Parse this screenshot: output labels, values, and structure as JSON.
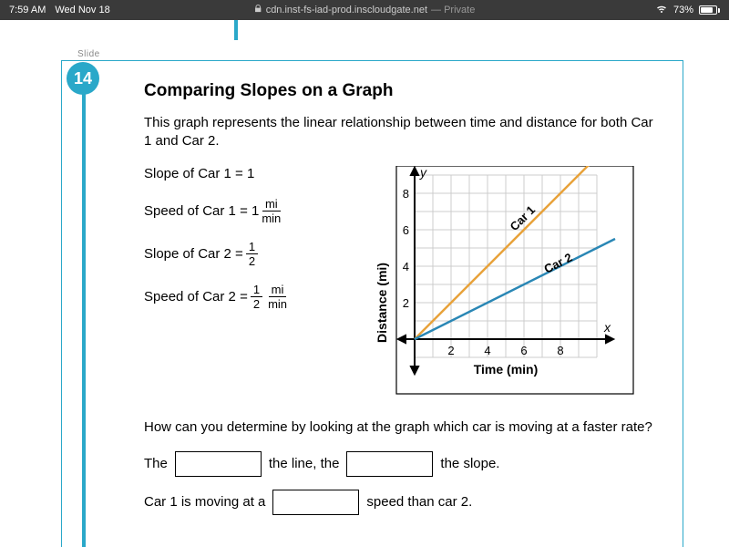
{
  "status": {
    "time": "7:59 AM",
    "date": "Wed Nov 18",
    "url": "cdn.inst-fs-iad-prod.inscloudgate.net",
    "url_suffix": " — Private",
    "battery_pct": "73%"
  },
  "slide": {
    "label": "Slide",
    "number": "14"
  },
  "title": "Comparing Slopes on a Graph",
  "intro": "This graph represents the linear relationship between time and distance for both Car 1 and Car 2.",
  "formulas": {
    "slope1_pre": "Slope of Car 1 = 1",
    "speed1_pre": "Speed of Car 1 = 1",
    "speed1_num": "mi",
    "speed1_den": "min",
    "slope2_pre": "Slope of Car 2 = ",
    "slope2_num": "1",
    "slope2_den": "2",
    "speed2_pre": "Speed of Car 2 = ",
    "speed2_f1_num": "1",
    "speed2_f1_den": "2",
    "speed2_f2_num": "mi",
    "speed2_f2_den": "min"
  },
  "chart_data": {
    "type": "line",
    "xlabel": "Time (min)",
    "ylabel": "Distance (mi)",
    "y_axis_label": "y",
    "x_axis_label": "x",
    "xlim": [
      0,
      10
    ],
    "ylim": [
      0,
      10
    ],
    "x_ticks": [
      2,
      4,
      6,
      8
    ],
    "y_ticks": [
      2,
      4,
      6,
      8
    ],
    "series": [
      {
        "name": "Car 1",
        "color": "#e8a23a",
        "points": [
          [
            0,
            0
          ],
          [
            10,
            10
          ]
        ]
      },
      {
        "name": "Car 2",
        "color": "#2a87b5",
        "points": [
          [
            0,
            0
          ],
          [
            10,
            5
          ]
        ]
      }
    ]
  },
  "question": "How can you determine by looking at the graph which car is moving at a faster rate?",
  "fill1": {
    "pre": "The",
    "mid": "the line, the",
    "post": "the slope."
  },
  "fill2": {
    "pre": "Car 1 is moving at a",
    "post": "speed than car 2."
  }
}
